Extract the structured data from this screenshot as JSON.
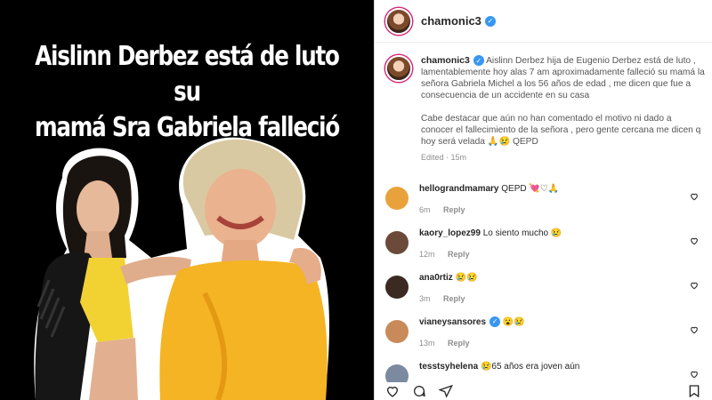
{
  "media": {
    "headline_line1": "Aislinn Derbez está de luto su",
    "headline_line2": "mamá Sra Gabriela falleció"
  },
  "post": {
    "username": "chamonic3",
    "caption": {
      "username": "chamonic3",
      "paragraph1": "Aislinn Derbez hija de Eugenio Derbez está de luto , lamentablemente hoy alas 7 am aproximadamente falleció su mamá la señora Gabriela Michel a los 56 años de edad , me dicen que fue a consecuencia de un accidente en su casa",
      "paragraph2": "Cabe destacar que aún no han comentado el motivo ni dado a conocer el fallecimiento de la señora , pero gente cercana me dicen q hoy será velada 🙏😢 QEPD",
      "meta": "Edited · 15m"
    },
    "comments": [
      {
        "user": "hellograndmamary",
        "text": "QEPD 💘♡🙏",
        "time": "6m",
        "reply": "Reply",
        "verified": false,
        "avatar_color": "#e9a23b"
      },
      {
        "user": "kaory_lopez99",
        "text": "Lo siento mucho 😢",
        "time": "12m",
        "reply": "Reply",
        "verified": false,
        "avatar_color": "#6b4a3a"
      },
      {
        "user": "ana0rtiz",
        "text": "😢😢",
        "time": "3m",
        "reply": "Reply",
        "verified": false,
        "avatar_color": "#3b2a22"
      },
      {
        "user": "vianeysansores",
        "text": "😮😢",
        "time": "13m",
        "reply": "Reply",
        "verified": true,
        "avatar_color": "#c98a5a"
      },
      {
        "user": "tesstsyhelena",
        "text": "😢65 años era joven aún",
        "time": "",
        "reply": "",
        "verified": false,
        "avatar_color": "#7c8aa0"
      }
    ]
  },
  "icons": {
    "like": "heart-icon",
    "comment": "comment-icon",
    "share": "share-icon",
    "save": "bookmark-icon"
  }
}
